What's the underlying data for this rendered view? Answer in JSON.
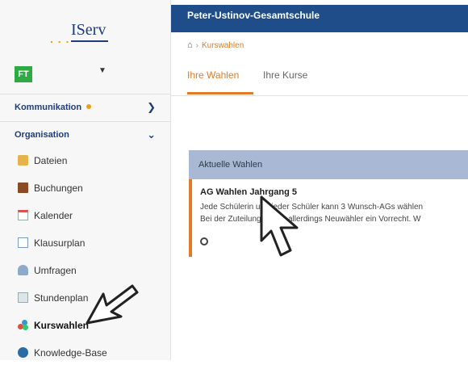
{
  "app": {
    "logo_text": "IServ"
  },
  "user": {
    "initials": "FT"
  },
  "sidebar": {
    "sections": [
      {
        "label": "Kommunikation"
      },
      {
        "label": "Organisation"
      }
    ],
    "items": [
      {
        "label": "Dateien",
        "icon": "folder-icon"
      },
      {
        "label": "Buchungen",
        "icon": "book-icon"
      },
      {
        "label": "Kalender",
        "icon": "calendar-icon"
      },
      {
        "label": "Klausurplan",
        "icon": "exam-plan-icon"
      },
      {
        "label": "Umfragen",
        "icon": "survey-icon"
      },
      {
        "label": "Stundenplan",
        "icon": "timetable-icon"
      },
      {
        "label": "Kurswahlen",
        "icon": "course-choice-icon",
        "active": true
      },
      {
        "label": "Knowledge-Base",
        "icon": "knowledge-base-icon"
      }
    ]
  },
  "header": {
    "school": "Peter-Ustinov-Gesamtschule"
  },
  "breadcrumb": {
    "current": "Kurswahlen"
  },
  "tabs": [
    {
      "label": "Ihre Wahlen",
      "active": true
    },
    {
      "label": "Ihre Kurse",
      "active": false
    }
  ],
  "panel": {
    "title": "Aktuelle Wahlen",
    "card": {
      "title": "AG Wahlen Jahrgang 5",
      "line1": "Jede Schülerin und jeder Schüler kann 3 Wunsch-AGs wählen",
      "line2": "Bei der Zuteilung haben allerdings Neuwähler ein Vorrecht. W"
    }
  },
  "colors": {
    "accent": "#e07b28",
    "header_bg": "#1f4d89",
    "panel_head": "#a9b9d3",
    "avatar": "#2eaa43"
  }
}
